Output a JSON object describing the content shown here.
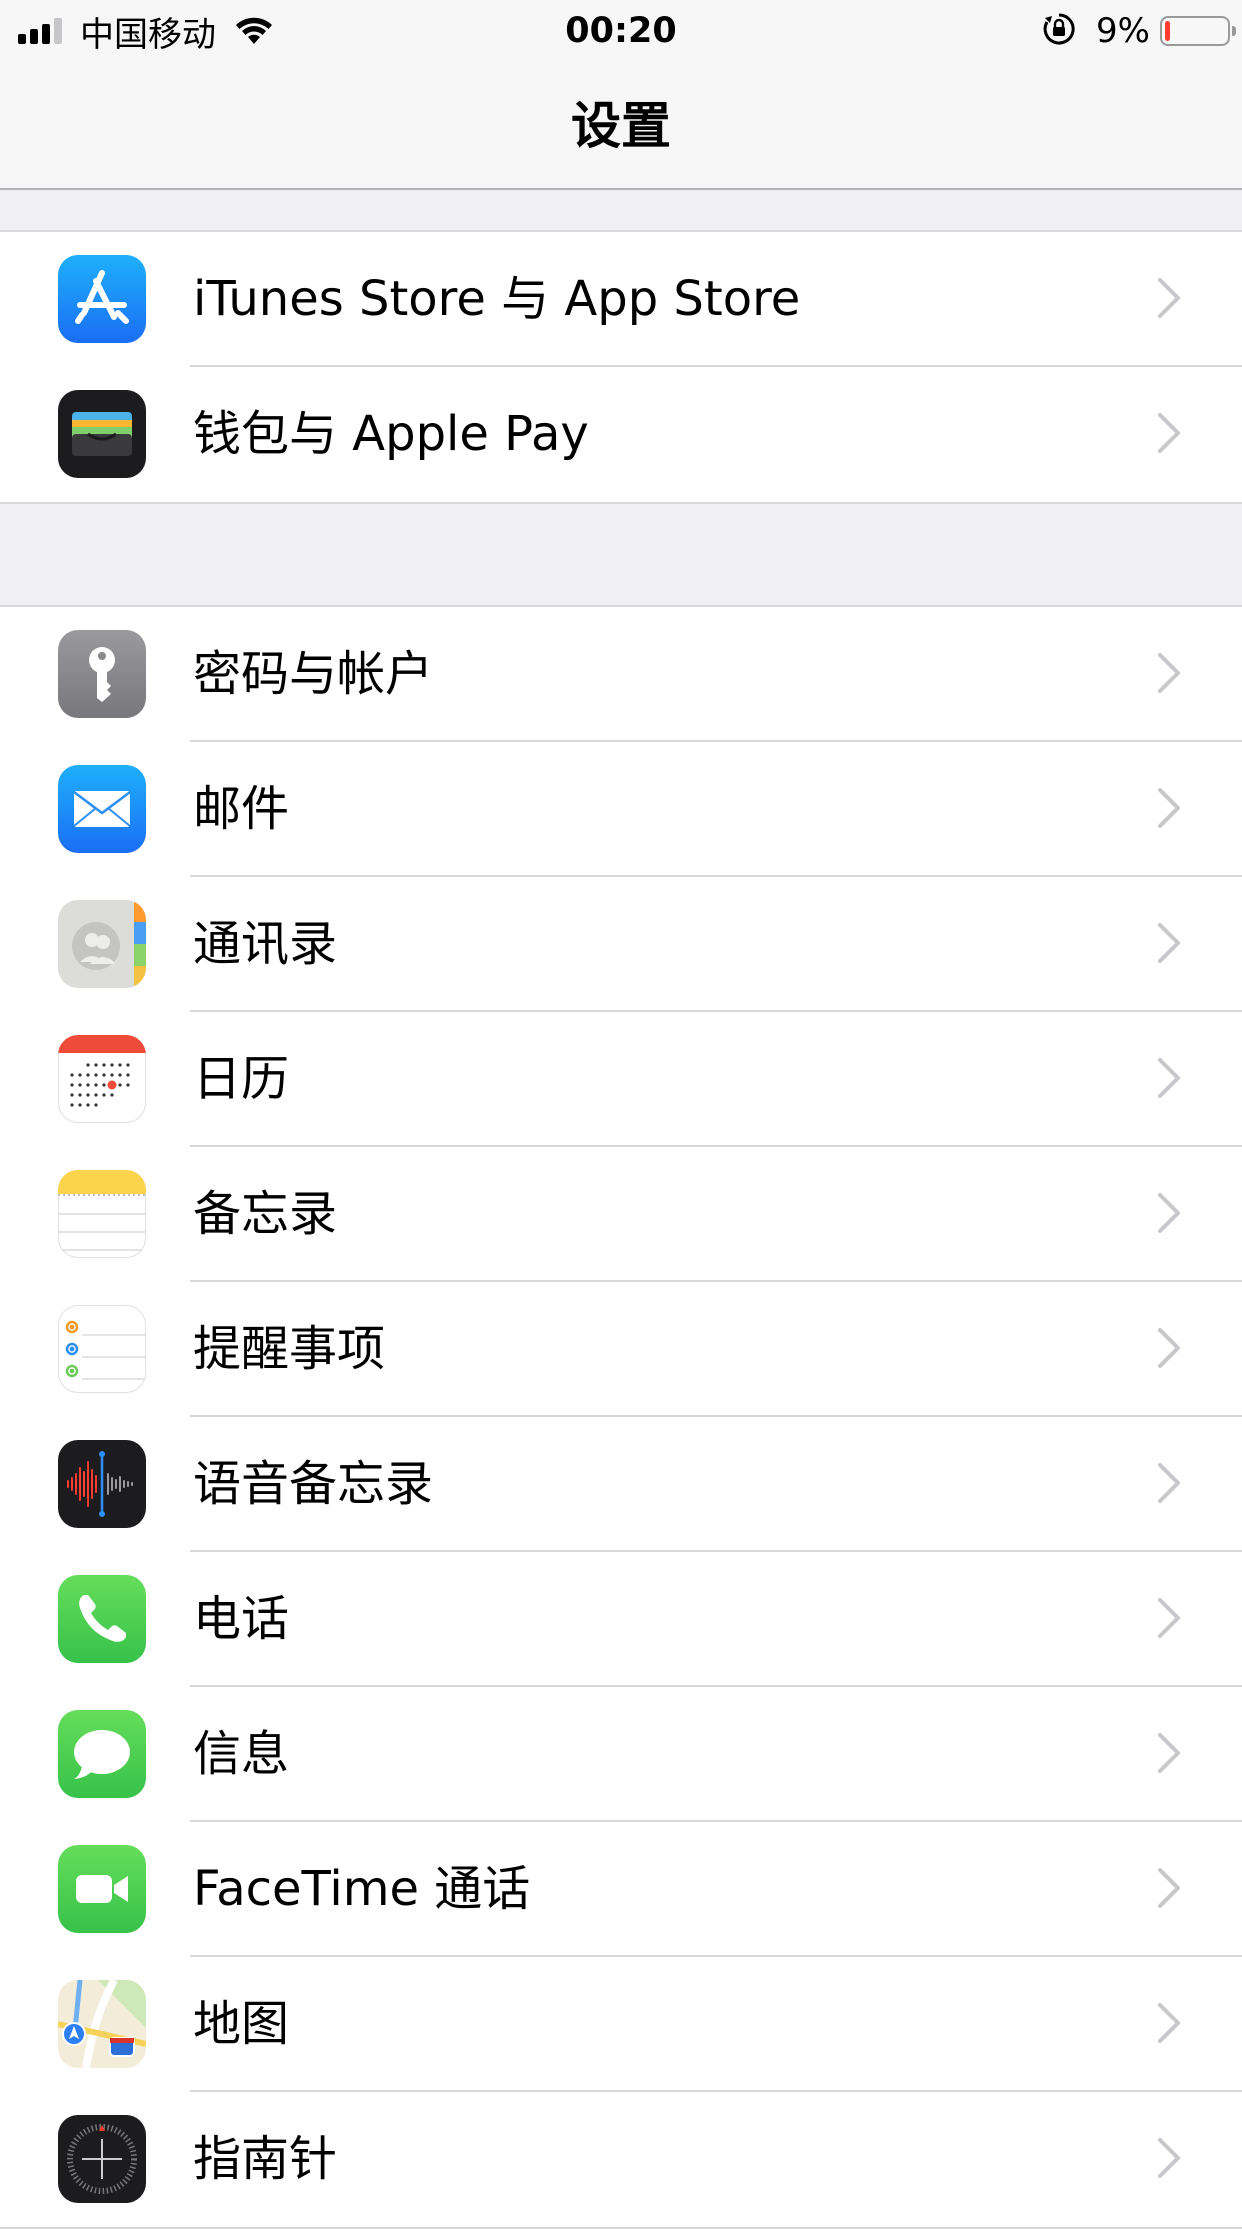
{
  "status_bar": {
    "carrier": "中国移动",
    "time": "00:20",
    "battery_percent_label": "9%",
    "battery_level": 0.09
  },
  "nav": {
    "title": "设置"
  },
  "group1": [
    {
      "label": "iTunes Store 与 App Store",
      "icon": "app-store-icon"
    },
    {
      "label": "钱包与 Apple Pay",
      "icon": "wallet-icon"
    }
  ],
  "group2": [
    {
      "label": "密码与帐户",
      "icon": "key-icon"
    },
    {
      "label": "邮件",
      "icon": "mail-icon"
    },
    {
      "label": "通讯录",
      "icon": "contacts-icon"
    },
    {
      "label": "日历",
      "icon": "calendar-icon"
    },
    {
      "label": "备忘录",
      "icon": "notes-icon"
    },
    {
      "label": "提醒事项",
      "icon": "reminders-icon"
    },
    {
      "label": "语音备忘录",
      "icon": "voice-memos-icon"
    },
    {
      "label": "电话",
      "icon": "phone-icon"
    },
    {
      "label": "信息",
      "icon": "messages-icon"
    },
    {
      "label": "FaceTime 通话",
      "icon": "facetime-icon"
    },
    {
      "label": "地图",
      "icon": "maps-icon"
    },
    {
      "label": "指南针",
      "icon": "compass-icon"
    }
  ],
  "colors": {
    "accent_blue": "#1a8cff",
    "battery_low": "#ff3b30",
    "group_background": "#efeff4"
  }
}
